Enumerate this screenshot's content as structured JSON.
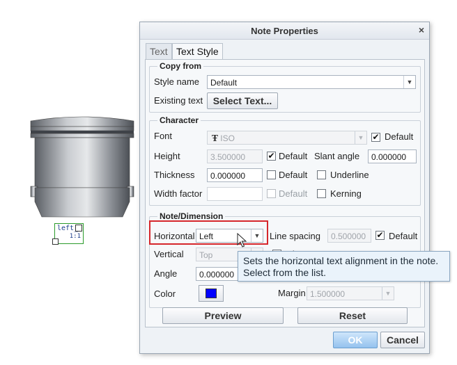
{
  "dialog": {
    "title": "Note Properties",
    "close_glyph": "×",
    "tabs": [
      {
        "label": "Text",
        "active": false
      },
      {
        "label": "Text Style",
        "active": true
      }
    ]
  },
  "copy_from": {
    "legend": "Copy from",
    "style_name_label": "Style name",
    "style_name_value": "Default",
    "existing_text_label": "Existing text",
    "select_text_button": "Select Text..."
  },
  "character": {
    "legend": "Character",
    "font_label": "Font",
    "font_value": "ISO",
    "font_default_label": "Default",
    "font_default_checked": true,
    "height_label": "Height",
    "height_value": "3.500000",
    "height_default_label": "Default",
    "height_default_checked": true,
    "slant_label": "Slant angle",
    "slant_value": "0.000000",
    "thickness_label": "Thickness",
    "thickness_value": "0.000000",
    "thickness_default_label": "Default",
    "thickness_default_checked": false,
    "underline_label": "Underline",
    "underline_checked": false,
    "width_factor_label": "Width factor",
    "width_factor_value": "",
    "width_default_label": "Default",
    "width_default_checked": false,
    "kerning_label": "Kerning",
    "kerning_checked": false
  },
  "note_dimension": {
    "legend": "Note/Dimension",
    "horizontal_label": "Horizontal",
    "horizontal_value": "Left",
    "line_spacing_label": "Line spacing",
    "line_spacing_value": "0.500000",
    "line_spacing_default_label": "Default",
    "line_spacing_default_checked": true,
    "vertical_label": "Vertical",
    "vertical_value": "Top",
    "mirror_label_partial": "Mi",
    "angle_label": "Angle",
    "angle_value": "0.000000",
    "color_label": "Color",
    "color_value": "#0000ff",
    "margin_label": "Margin",
    "margin_value": "1.500000"
  },
  "buttons": {
    "preview": "Preview",
    "reset": "Reset",
    "ok": "OK",
    "cancel": "Cancel"
  },
  "tooltip": {
    "line1": "Sets the horizontal text alignment in the note.",
    "line2": "Select from the list."
  },
  "annotation": {
    "text": "left_",
    "scale": "1:1"
  },
  "colors": {
    "highlight": "#d6262b",
    "ok_button": "#94c2ee",
    "annotation_border": "#2a9a2a",
    "swatch": "#0000ff"
  }
}
